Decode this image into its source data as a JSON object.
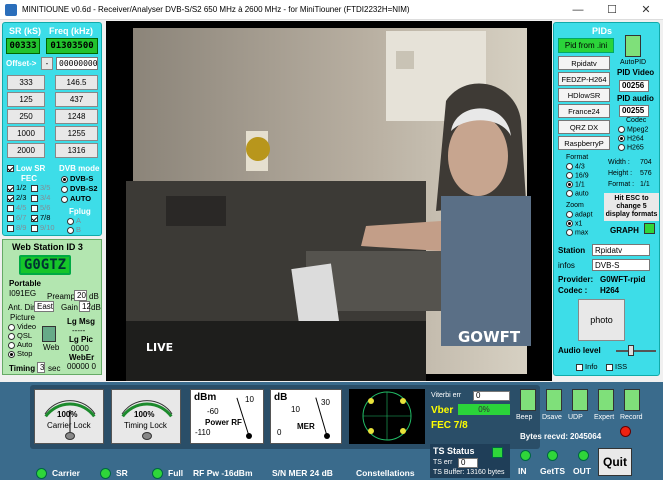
{
  "window": {
    "title": "MINITIOUNE v0.6d - Receiver/Analyser DVB-S/S2 650 MHz à 2600 MHz - for MiniTiouner (FTDI2232H=NIM)",
    "minimize": "—",
    "maximize": "☐",
    "close": "✕"
  },
  "tuner": {
    "sr_label": "SR (kS)",
    "freq_label": "Freq (kHz)",
    "sr_value": "00333",
    "freq_value": "01303500",
    "offset_label": "Offset->",
    "offset_minus": "-",
    "offset_value": "00000000",
    "sr_presets": [
      "333",
      "125",
      "250",
      "1000",
      "2000"
    ],
    "freq_presets": [
      "146.5",
      "437",
      "1248",
      "1255",
      "1316"
    ],
    "low_sr_label": "Low SR",
    "fec_label": "FEC",
    "dvb_mode_label": "DVB mode",
    "dvb_modes": [
      "DVB-S",
      "DVB-S2",
      "AUTO"
    ],
    "fec_rows": [
      [
        "1/2",
        "3/5"
      ],
      [
        "2/3",
        "3/4"
      ],
      [
        "4/5",
        "5/6"
      ],
      [
        "6/7",
        "7/8"
      ],
      [
        "8/9",
        "9/10"
      ]
    ],
    "fplug_label": "Fplug",
    "fplug_opts": [
      "A",
      "B"
    ]
  },
  "webstation": {
    "title": "Web Station ID 3",
    "callsign": "G0GTZ",
    "portable_label": "Portable",
    "locator": "I091EG",
    "preamp_label": "Preamp",
    "preamp_value": "20",
    "db1": "dB",
    "ant_label": "Ant. Dir.",
    "ant_value": "East",
    "gain_label": "Gain",
    "gain_value": "12",
    "db2": "dB",
    "picture_label": "Picture",
    "picture_opts": [
      "Video",
      "QSL",
      "Auto",
      "Stop"
    ],
    "web_label": "Web",
    "lg_msg": "Lg Msg",
    "lg_msg_val": "-----",
    "lg_pic": "Lg Pic",
    "lg_pic_val": "0000",
    "weber": "WebEr",
    "weber_val": "00000 0",
    "timing_label": "Timing",
    "timing_value": "3",
    "sec": "sec"
  },
  "video": {
    "overlay_live": "LIVE",
    "overlay_call": "GOWFT"
  },
  "pids": {
    "title": "PIDs",
    "pid_button": "Pid from .ini",
    "auto_pid": "AutoPID",
    "channels": [
      "Rpidatv",
      "FEDZP-H264",
      "HDlowSR",
      "France24",
      "QRZ DX",
      "RaspberryP"
    ],
    "pid_video_label": "PID Video",
    "pid_video": "00256",
    "pid_audio_label": "PID audio",
    "pid_audio": "00255",
    "codec_label": "Codec",
    "codecs": [
      "Mpeg2",
      "H264",
      "H265"
    ],
    "format_label": "Format",
    "formats": [
      "4/3",
      "16/9",
      "1/1",
      "auto"
    ],
    "width_label": "Width :",
    "width_val": "704",
    "height_label": "Height :",
    "height_val": "576",
    "format_lbl2": "Format :",
    "format_val": "1/1",
    "esc_hint": "Hit ESC to change 5 display formats",
    "zoom_label": "Zoom",
    "zooms": [
      "adapt",
      "x1",
      "max"
    ],
    "graph": "GRAPH",
    "station_label": "Station",
    "station_value": "Rpidatv",
    "infos_label": "infos",
    "infos_value": "DVB-S",
    "provider_label": "Provider:",
    "provider_value": "G0WFT-rpid",
    "codec2_label": "Codec :",
    "codec2_value": "H264",
    "photo": "photo",
    "audio_level": "Audio level",
    "info_cb": "Info",
    "iss_cb": "ISS"
  },
  "status": {
    "carrier_pct": "100%",
    "carrier_lock": "Carrier Lock",
    "carrier_level": 1.0,
    "timing_pct": "100%",
    "timing_lock": "Timing Lock",
    "timing_level": 1.0,
    "power_unit": "dBm",
    "power_title": "Power RF",
    "power_ticks": [
      "-60",
      "10",
      "-110"
    ],
    "power_value": -16,
    "mer_unit": "dB",
    "mer_title": "MER",
    "mer_ticks": [
      "10",
      "30",
      "0"
    ],
    "mer_value": 24,
    "vitber_label": "Viterbi err",
    "vitber_value": "0",
    "vber_label": "Vber",
    "vber_value": "0%",
    "fec": "FEC 7/8",
    "ts_status": "TS Status",
    "ts_err_label": "TS err",
    "ts_err_value": "0",
    "ts_buffer": "TS Buffer: 13160 bytes",
    "switches": [
      "Beep",
      "Dsave",
      "UDP",
      "Expert",
      "Record"
    ],
    "bytes_label": "Bytes recvd:",
    "bytes_value": "2045064",
    "in_label": "IN",
    "getts_label": "GetTS",
    "out_label": "OUT",
    "quit": "Quit",
    "bottom_carrier": "Carrier",
    "bottom_sr": "SR",
    "bottom_full": "Full",
    "rf_pw": "RF Pw  -16dBm",
    "sn_mer": "S/N MER   24 dB",
    "constellations": "Constellations",
    "colors": {
      "panel": "#3ddde8",
      "led_green": "#2fd63a",
      "lcd": "#22c32e",
      "bottom": "#3a6b8c"
    }
  }
}
